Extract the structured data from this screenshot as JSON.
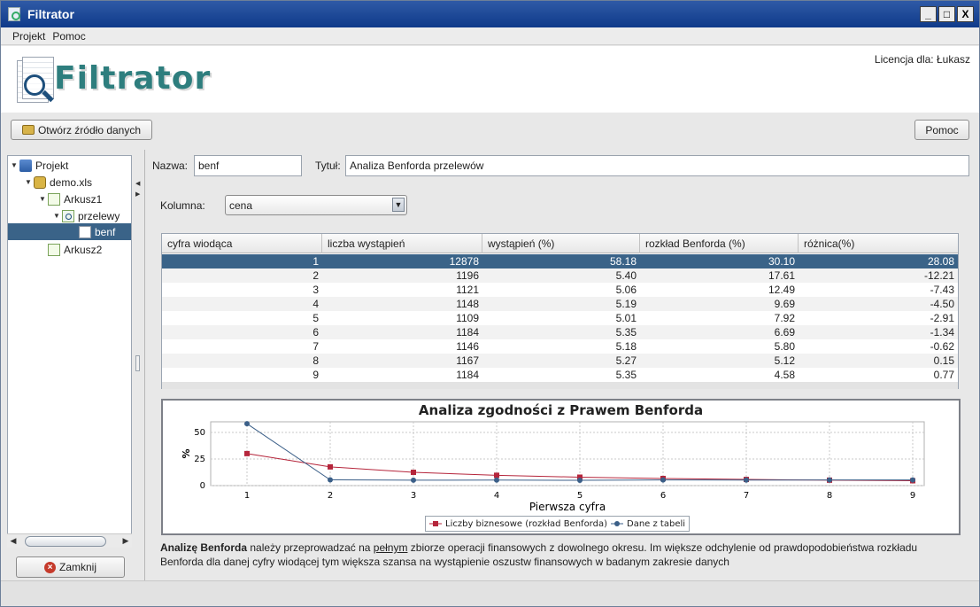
{
  "window": {
    "title": "Filtrator",
    "buttons": [
      "_",
      "□",
      "X"
    ]
  },
  "menu": {
    "items": [
      "Projekt",
      "Pomoc"
    ]
  },
  "banner": {
    "logo_text": "Filtrator",
    "license_text": "Licencja dla: Łukasz"
  },
  "toolbar": {
    "open_label": "Otwórz źródło danych",
    "help_label": "Pomoc"
  },
  "tree": {
    "items": [
      {
        "label": "Projekt",
        "icon": "project-icon",
        "toggle": "▼"
      },
      {
        "label": "demo.xls",
        "icon": "database-icon",
        "toggle": "▼"
      },
      {
        "label": "Arkusz1",
        "icon": "sheet-icon",
        "toggle": "▼"
      },
      {
        "label": "przelewy",
        "icon": "filter-icon",
        "toggle": "▼"
      },
      {
        "label": "benf",
        "icon": "document-icon",
        "toggle": ""
      },
      {
        "label": "Arkusz2",
        "icon": "sheet-icon",
        "toggle": ""
      }
    ],
    "selected": "benf"
  },
  "close_button": {
    "label": "Zamknij"
  },
  "form": {
    "name_label": "Nazwa:",
    "name_value": "benf",
    "title_label": "Tytuł:",
    "title_value": "Analiza Benforda przelewów",
    "column_label": "Kolumna:",
    "column_value": "cena"
  },
  "table": {
    "headers": [
      "cyfra wiodąca",
      "liczba wystąpień",
      "wystąpień (%)",
      "rozkład Benforda (%)",
      "różnica(%)"
    ],
    "rows": [
      [
        "1",
        "12878",
        "58.18",
        "30.10",
        "28.08"
      ],
      [
        "2",
        "1196",
        "5.40",
        "17.61",
        "-12.21"
      ],
      [
        "3",
        "1121",
        "5.06",
        "12.49",
        "-7.43"
      ],
      [
        "4",
        "1148",
        "5.19",
        "9.69",
        "-4.50"
      ],
      [
        "5",
        "1109",
        "5.01",
        "7.92",
        "-2.91"
      ],
      [
        "6",
        "1184",
        "5.35",
        "6.69",
        "-1.34"
      ],
      [
        "7",
        "1146",
        "5.18",
        "5.80",
        "-0.62"
      ],
      [
        "8",
        "1167",
        "5.27",
        "5.12",
        "0.15"
      ],
      [
        "9",
        "1184",
        "5.35",
        "4.58",
        "0.77"
      ]
    ],
    "selected_row": 0
  },
  "chart_data": {
    "type": "line",
    "title": "Analiza zgodności z Prawem Benforda",
    "xlabel": "Pierwsza cyfra",
    "ylabel": "%",
    "x": [
      1,
      2,
      3,
      4,
      5,
      6,
      7,
      8,
      9
    ],
    "yticks": [
      0,
      25,
      50
    ],
    "ylim": [
      0,
      60
    ],
    "grid": true,
    "legend_position": "bottom",
    "series": [
      {
        "name": "Liczby biznesowe (rozkład Benforda)",
        "color": "#b5253b",
        "marker": "square",
        "values": [
          30.1,
          17.61,
          12.49,
          9.69,
          7.92,
          6.69,
          5.8,
          5.12,
          4.58
        ]
      },
      {
        "name": "Dane z tabeli",
        "color": "#3b5f88",
        "marker": "circle",
        "values": [
          58.18,
          5.4,
          5.06,
          5.19,
          5.01,
          5.35,
          5.18,
          5.27,
          5.35
        ]
      }
    ]
  },
  "description": {
    "bold_lead": "Analizę Benforda",
    "text_1": " należy przeprowadzać na ",
    "underlined": "pełnym",
    "text_2": " zbiorze operacji finansowych z dowolnego okresu. Im większe odchylenie od prawdopodobieństwa rozkładu Benforda dla danej cyfry wiodącej tym większa szansa na wystąpienie oszustw finansowych w badanym zakresie danych"
  },
  "colors": {
    "selection": "#3a6388",
    "titlebar": "#1f4a96"
  }
}
